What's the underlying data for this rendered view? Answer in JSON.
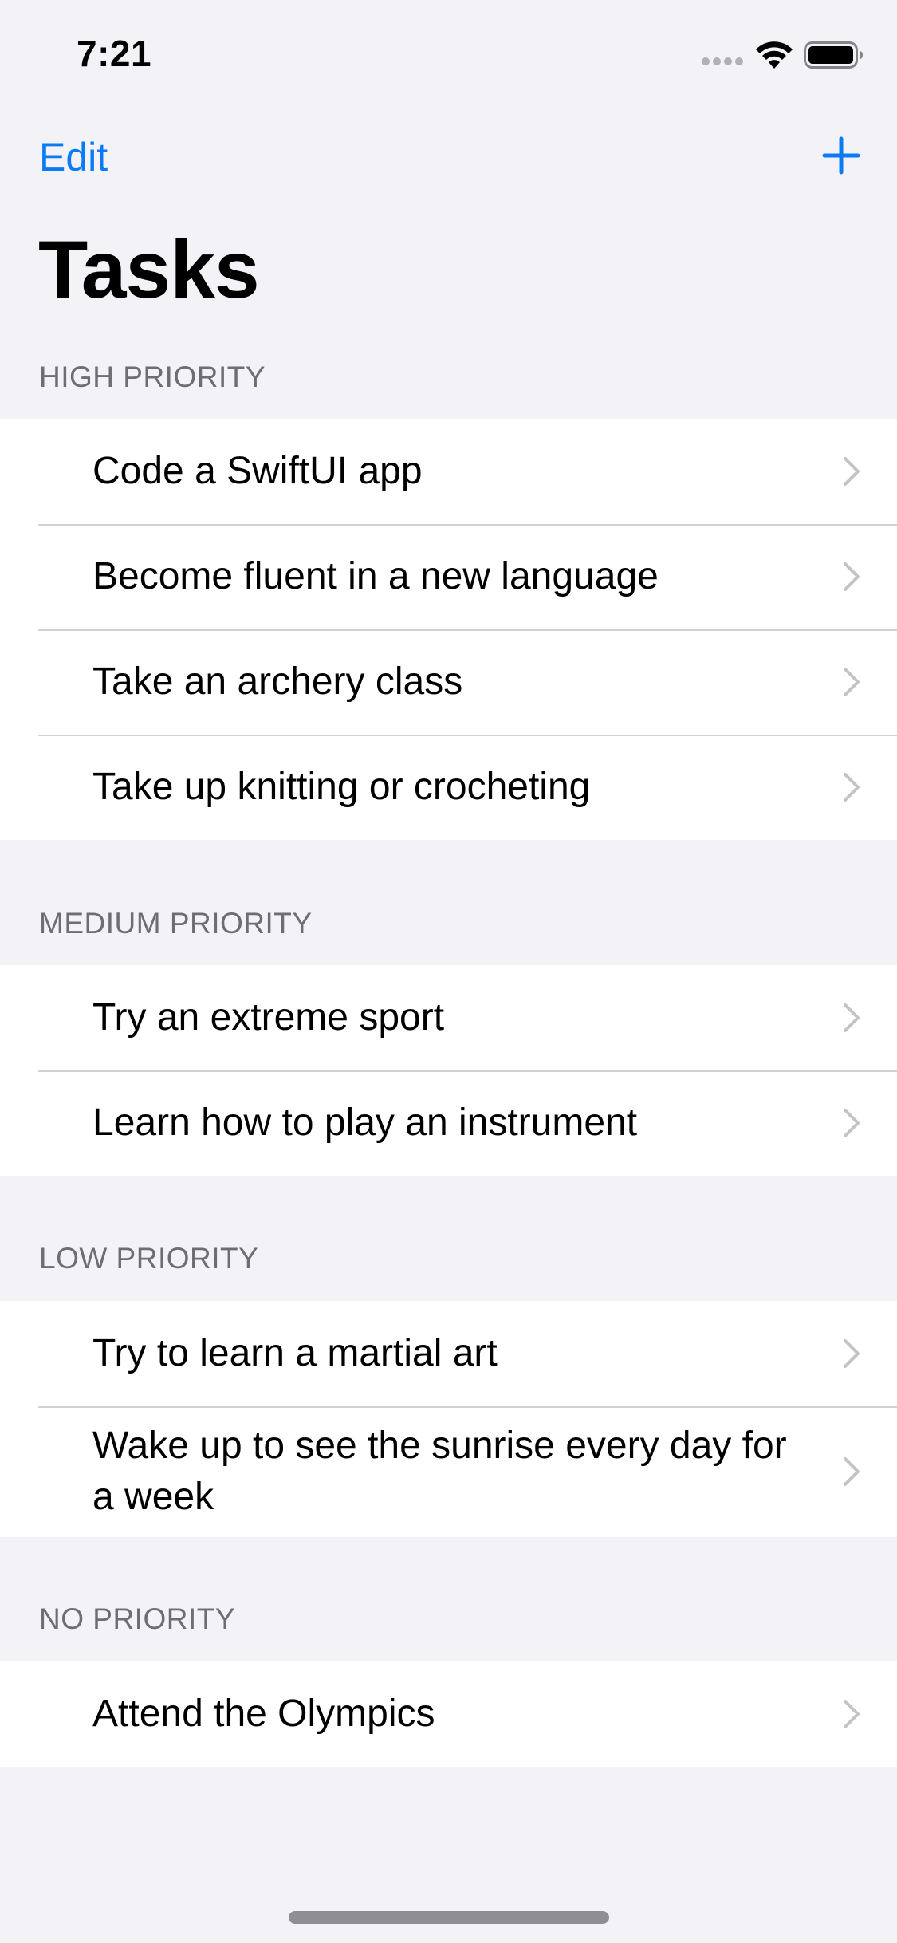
{
  "status_bar": {
    "time": "7:21"
  },
  "nav": {
    "edit_label": "Edit",
    "add_icon": "plus-icon"
  },
  "title": "Tasks",
  "sections": [
    {
      "header": "HIGH PRIORITY",
      "items": [
        "Code a SwiftUI app",
        "Become fluent in a new language",
        "Take an archery class",
        "Take up knitting or crocheting"
      ]
    },
    {
      "header": "MEDIUM PRIORITY",
      "items": [
        "Try an extreme sport",
        "Learn how to play an instrument"
      ]
    },
    {
      "header": "LOW PRIORITY",
      "items": [
        "Try to learn a martial art",
        "Wake up to see the sunrise every day for a week"
      ]
    },
    {
      "header": "NO PRIORITY",
      "items": [
        "Attend the Olympics"
      ]
    }
  ],
  "colors": {
    "accent": "#0a7bf5",
    "background": "#f2f2f7",
    "secondary_text": "#6d6d72",
    "chevron": "#c4c4c7"
  }
}
